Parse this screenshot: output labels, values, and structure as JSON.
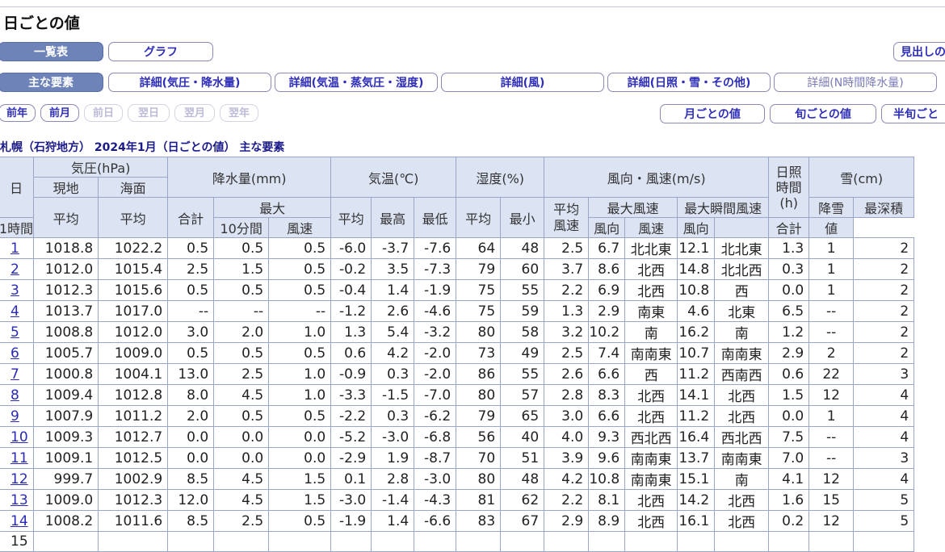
{
  "page": {
    "title": "日ごとの値"
  },
  "tabs": [
    {
      "label": "一覧表",
      "selected": true
    },
    {
      "label": "グラフ",
      "selected": false
    }
  ],
  "midashi": "見出しの",
  "detail_tabs": [
    {
      "label": "主な要素",
      "selected": true
    },
    {
      "label": "詳細(気圧・降水量)"
    },
    {
      "label": "詳細(気温・蒸気圧・湿度)"
    },
    {
      "label": "詳細(風)"
    },
    {
      "label": "詳細(日照・雪・その他)"
    },
    {
      "label": "詳細(N時間降水量)"
    }
  ],
  "nav": {
    "prev_year": "前年",
    "prev_month": "前月",
    "prev_day": "前日",
    "next_day": "翌日",
    "next_month": "翌月",
    "next_year": "翌年"
  },
  "periods": {
    "monthly": "月ごとの値",
    "dekad": "旬ごとの値",
    "half_dekad": "半旬ごと"
  },
  "subtitle": "札幌（石狩地方） 2024年1月（日ごとの値） 主な要素",
  "header": {
    "day": "日",
    "pressure": "気圧(hPa)",
    "station": "現地",
    "sea_level": "海面",
    "avg": "平均",
    "precip": "降水量(mm)",
    "total": "合計",
    "max": "最大",
    "hour1": "1時間",
    "min10": "10分間",
    "temp": "気温(℃)",
    "highest": "最高",
    "lowest": "最低",
    "humidity": "湿度(%)",
    "min": "最小",
    "wind": "風向・風速(m/s)",
    "avg_wind": "平均\n風速",
    "max_wind": "最大風速",
    "max_gust": "最大瞬間風速",
    "speed": "風速",
    "direction": "風向",
    "sunshine": "日照\n時間\n(h)",
    "snow": "雪(cm)",
    "snowfall": "降雪",
    "snow_total": "合計",
    "max_depth": "最深積",
    "value": "値"
  },
  "rows": [
    {
      "day": "1",
      "p_st": "1018.8",
      "p_sea": "1022.2",
      "pr_tot": "0.5",
      "pr_1h": "0.5",
      "pr_10m": "0.5",
      "t_avg": "-6.0",
      "t_max": "-3.7",
      "t_min": "-7.6",
      "h_avg": "64",
      "h_min": "48",
      "w_avg": "2.5",
      "w_max": "6.7",
      "w_max_dir": "北北東",
      "g_max": "12.1",
      "g_dir": "北北東",
      "sun": "1.3",
      "snowfall": "1",
      "depth": "2"
    },
    {
      "day": "2",
      "p_st": "1012.0",
      "p_sea": "1015.4",
      "pr_tot": "2.5",
      "pr_1h": "1.5",
      "pr_10m": "0.5",
      "t_avg": "-0.2",
      "t_max": "3.5",
      "t_min": "-7.3",
      "h_avg": "79",
      "h_min": "60",
      "w_avg": "3.7",
      "w_max": "8.6",
      "w_max_dir": "北西",
      "g_max": "14.8",
      "g_dir": "北北西",
      "sun": "0.3",
      "snowfall": "1",
      "depth": "2"
    },
    {
      "day": "3",
      "p_st": "1012.3",
      "p_sea": "1015.6",
      "pr_tot": "0.5",
      "pr_1h": "0.5",
      "pr_10m": "0.5",
      "t_avg": "-0.4",
      "t_max": "1.4",
      "t_min": "-1.9",
      "h_avg": "75",
      "h_min": "55",
      "w_avg": "2.2",
      "w_max": "6.9",
      "w_max_dir": "北西",
      "g_max": "10.8",
      "g_dir": "西",
      "sun": "0.0",
      "snowfall": "1",
      "depth": "2"
    },
    {
      "day": "4",
      "p_st": "1013.7",
      "p_sea": "1017.0",
      "pr_tot": "--",
      "pr_1h": "--",
      "pr_10m": "--",
      "t_avg": "-1.2",
      "t_max": "2.6",
      "t_min": "-4.6",
      "h_avg": "75",
      "h_min": "59",
      "w_avg": "1.3",
      "w_max": "2.9",
      "w_max_dir": "南東",
      "g_max": "4.6",
      "g_dir": "北東",
      "sun": "6.5",
      "snowfall": "--",
      "depth": "2"
    },
    {
      "day": "5",
      "p_st": "1008.8",
      "p_sea": "1012.0",
      "pr_tot": "3.0",
      "pr_1h": "2.0",
      "pr_10m": "1.0",
      "t_avg": "1.3",
      "t_max": "5.4",
      "t_min": "-3.2",
      "h_avg": "80",
      "h_min": "58",
      "w_avg": "3.2",
      "w_max": "10.2",
      "w_max_dir": "南",
      "g_max": "16.2",
      "g_dir": "南",
      "sun": "1.2",
      "snowfall": "--",
      "depth": "2"
    },
    {
      "day": "6",
      "p_st": "1005.7",
      "p_sea": "1009.0",
      "pr_tot": "0.5",
      "pr_1h": "0.5",
      "pr_10m": "0.5",
      "t_avg": "0.6",
      "t_max": "4.2",
      "t_min": "-2.0",
      "h_avg": "73",
      "h_min": "49",
      "w_avg": "2.5",
      "w_max": "7.4",
      "w_max_dir": "南南東",
      "g_max": "10.7",
      "g_dir": "南南東",
      "sun": "2.9",
      "snowfall": "2",
      "depth": "2"
    },
    {
      "day": "7",
      "p_st": "1000.8",
      "p_sea": "1004.1",
      "pr_tot": "13.0",
      "pr_1h": "2.5",
      "pr_10m": "1.0",
      "t_avg": "-0.9",
      "t_max": "0.3",
      "t_min": "-2.0",
      "h_avg": "86",
      "h_min": "55",
      "w_avg": "2.6",
      "w_max": "6.6",
      "w_max_dir": "西",
      "g_max": "11.2",
      "g_dir": "西南西",
      "sun": "0.6",
      "snowfall": "22",
      "depth": "3"
    },
    {
      "day": "8",
      "p_st": "1009.4",
      "p_sea": "1012.8",
      "pr_tot": "8.0",
      "pr_1h": "4.5",
      "pr_10m": "1.0",
      "t_avg": "-3.3",
      "t_max": "-1.5",
      "t_min": "-7.0",
      "h_avg": "80",
      "h_min": "57",
      "w_avg": "2.8",
      "w_max": "8.3",
      "w_max_dir": "北西",
      "g_max": "14.1",
      "g_dir": "北西",
      "sun": "1.5",
      "snowfall": "12",
      "depth": "4"
    },
    {
      "day": "9",
      "p_st": "1007.9",
      "p_sea": "1011.2",
      "pr_tot": "2.0",
      "pr_1h": "0.5",
      "pr_10m": "0.5",
      "t_avg": "-2.2",
      "t_max": "0.3",
      "t_min": "-6.2",
      "h_avg": "79",
      "h_min": "65",
      "w_avg": "3.0",
      "w_max": "6.6",
      "w_max_dir": "北西",
      "g_max": "11.2",
      "g_dir": "北西",
      "sun": "0.0",
      "snowfall": "1",
      "depth": "4"
    },
    {
      "day": "10",
      "p_st": "1009.3",
      "p_sea": "1012.7",
      "pr_tot": "0.0",
      "pr_1h": "0.0",
      "pr_10m": "0.0",
      "t_avg": "-5.2",
      "t_max": "-3.0",
      "t_min": "-6.8",
      "h_avg": "56",
      "h_min": "40",
      "w_avg": "4.0",
      "w_max": "9.3",
      "w_max_dir": "西北西",
      "g_max": "16.4",
      "g_dir": "西北西",
      "sun": "7.5",
      "snowfall": "--",
      "depth": "4"
    },
    {
      "day": "11",
      "p_st": "1009.1",
      "p_sea": "1012.5",
      "pr_tot": "0.0",
      "pr_1h": "0.0",
      "pr_10m": "0.0",
      "t_avg": "-2.9",
      "t_max": "1.9",
      "t_min": "-8.7",
      "h_avg": "70",
      "h_min": "51",
      "w_avg": "3.9",
      "w_max": "9.6",
      "w_max_dir": "南南東",
      "g_max": "13.7",
      "g_dir": "南南東",
      "sun": "7.0",
      "snowfall": "--",
      "depth": "3"
    },
    {
      "day": "12",
      "p_st": "999.7",
      "p_sea": "1002.9",
      "pr_tot": "8.5",
      "pr_1h": "4.5",
      "pr_10m": "1.5",
      "t_avg": "0.1",
      "t_max": "2.8",
      "t_min": "-3.0",
      "h_avg": "80",
      "h_min": "48",
      "w_avg": "4.2",
      "w_max": "10.8",
      "w_max_dir": "南南東",
      "g_max": "15.1",
      "g_dir": "南",
      "sun": "4.1",
      "snowfall": "12",
      "depth": "4"
    },
    {
      "day": "13",
      "p_st": "1009.0",
      "p_sea": "1012.3",
      "pr_tot": "12.0",
      "pr_1h": "4.5",
      "pr_10m": "1.5",
      "t_avg": "-3.0",
      "t_max": "-1.4",
      "t_min": "-4.3",
      "h_avg": "81",
      "h_min": "62",
      "w_avg": "2.2",
      "w_max": "8.1",
      "w_max_dir": "北西",
      "g_max": "14.2",
      "g_dir": "北西",
      "sun": "1.6",
      "snowfall": "15",
      "depth": "5"
    },
    {
      "day": "14",
      "p_st": "1008.2",
      "p_sea": "1011.6",
      "pr_tot": "8.5",
      "pr_1h": "2.5",
      "pr_10m": "0.5",
      "t_avg": "-1.9",
      "t_max": "1.4",
      "t_min": "-6.6",
      "h_avg": "83",
      "h_min": "67",
      "w_avg": "2.9",
      "w_max": "8.9",
      "w_max_dir": "北西",
      "g_max": "16.1",
      "g_dir": "北西",
      "sun": "0.2",
      "snowfall": "12",
      "depth": "5"
    },
    {
      "day": "15"
    }
  ]
}
